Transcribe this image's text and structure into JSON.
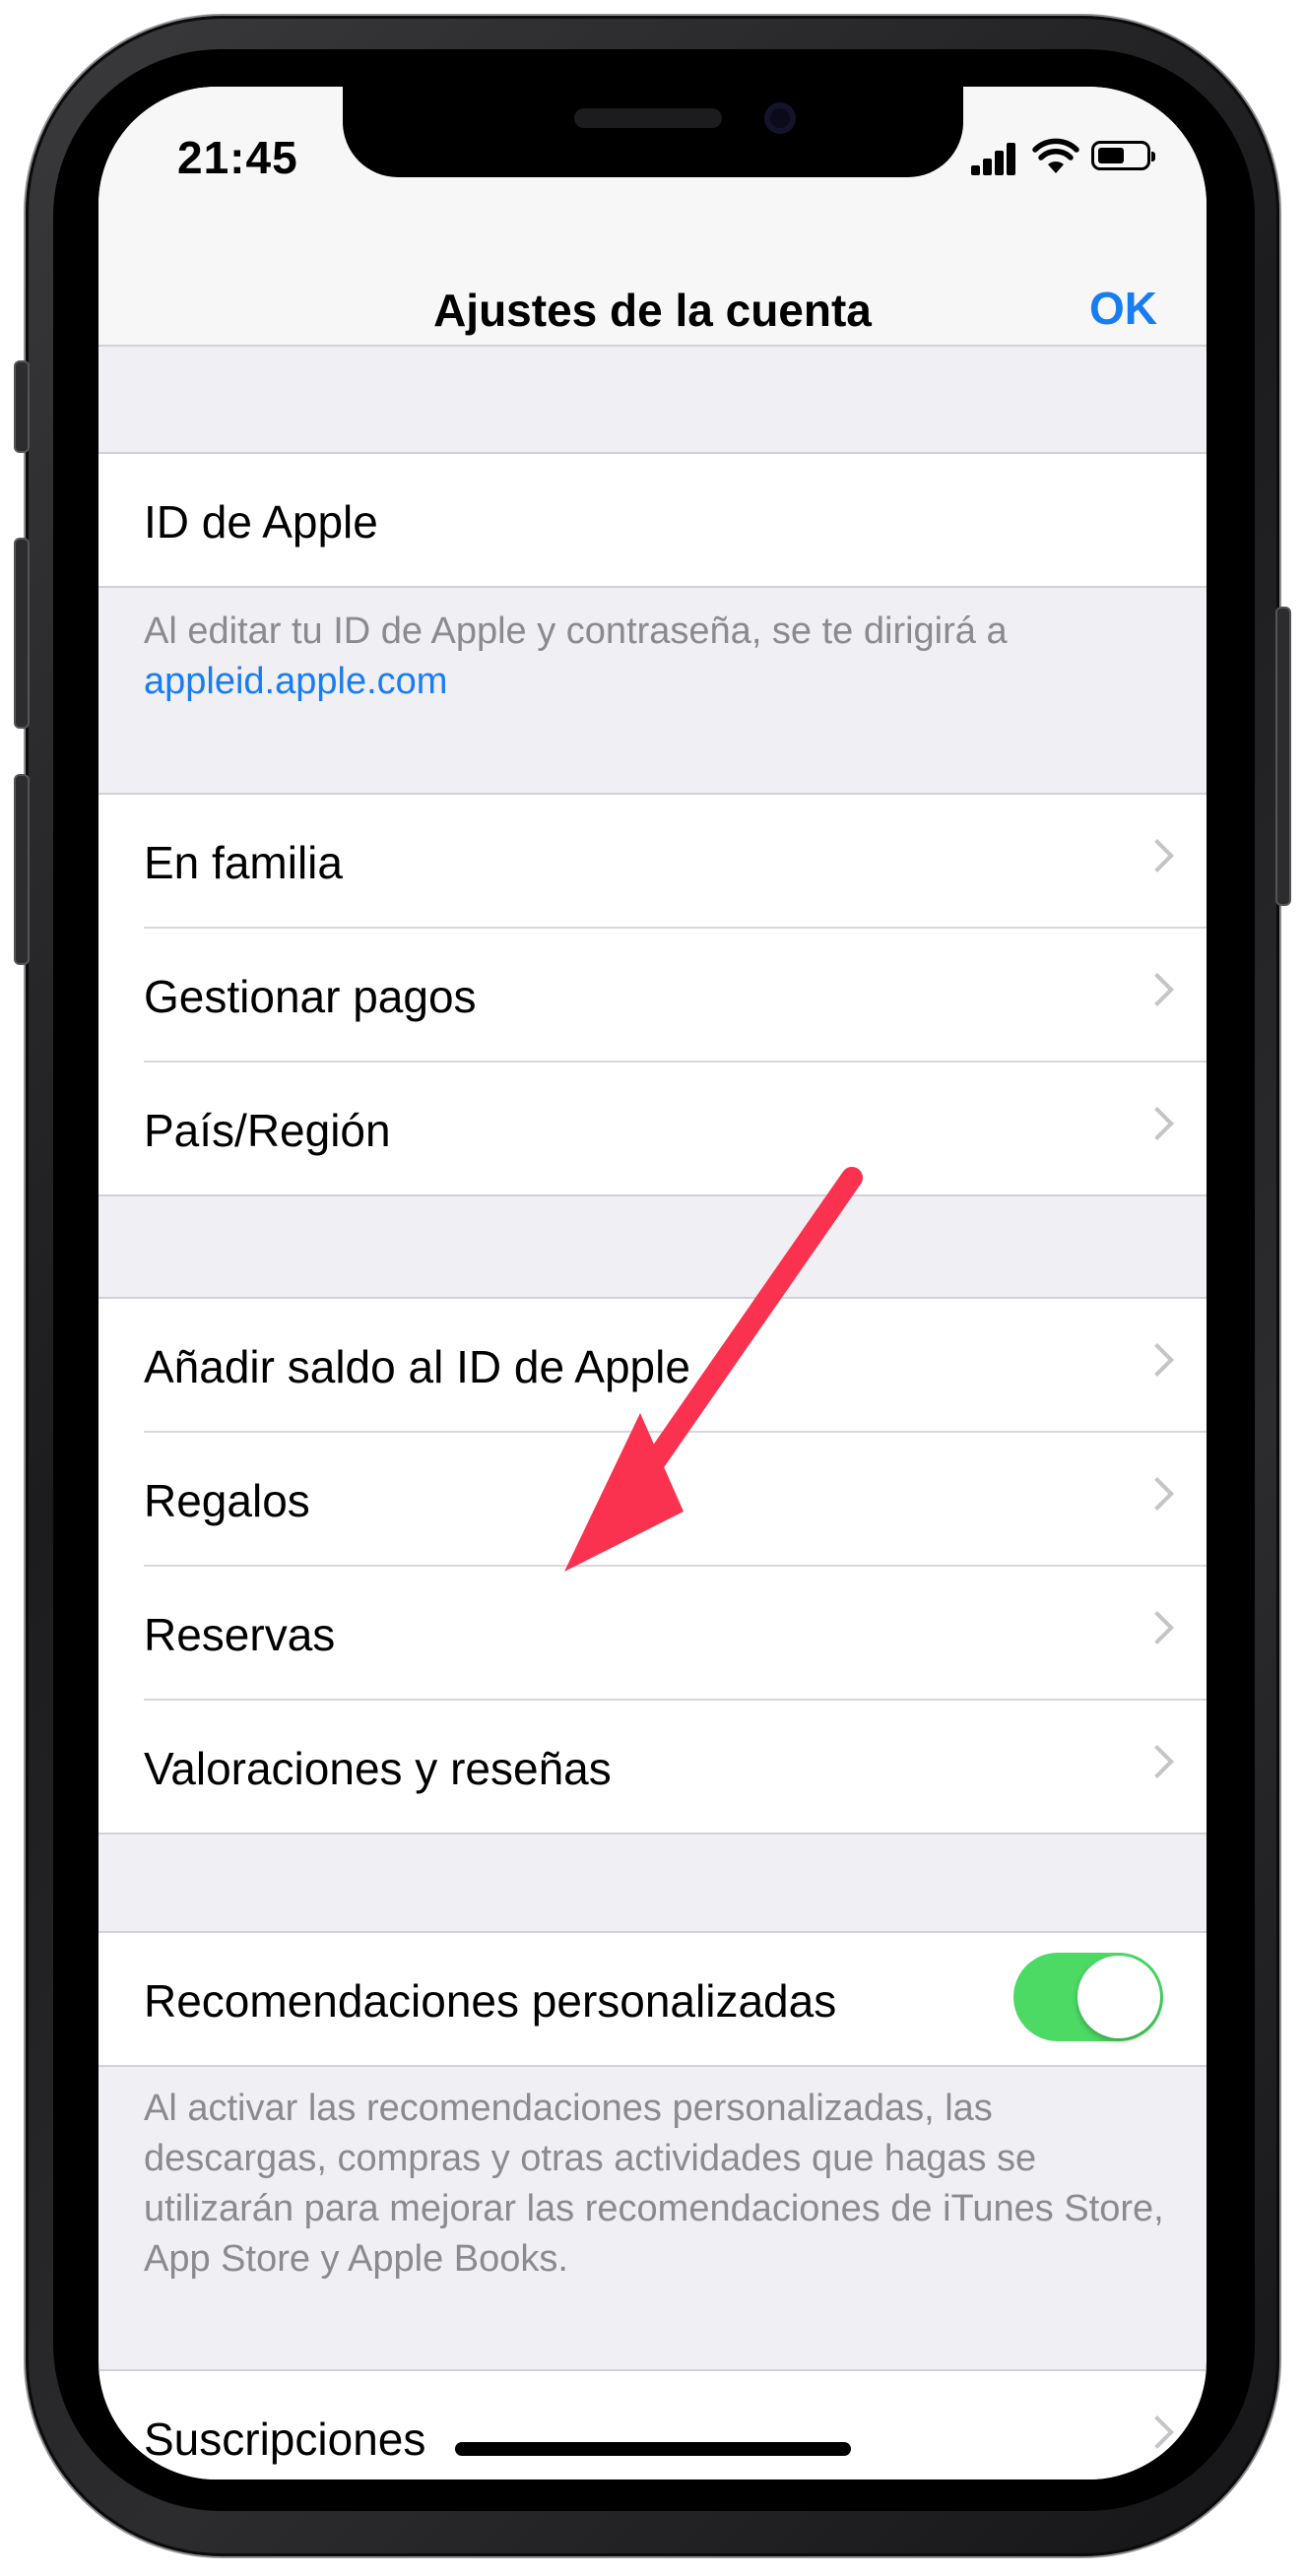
{
  "status_bar": {
    "time": "21:45"
  },
  "nav": {
    "title": "Ajustes de la cuenta",
    "done_label": "OK"
  },
  "apple_id": {
    "label": "ID de Apple",
    "note_text": "Al editar tu ID de Apple y contraseña, se te dirigirá a",
    "note_link": "appleid.apple.com"
  },
  "group1": [
    {
      "label": "En familia"
    },
    {
      "label": "Gestionar pagos"
    },
    {
      "label": "País/Región"
    }
  ],
  "group2": [
    {
      "label": "Añadir saldo al ID de Apple"
    },
    {
      "label": "Regalos"
    },
    {
      "label": "Reservas"
    },
    {
      "label": "Valoraciones y reseñas"
    }
  ],
  "recommendations": {
    "label": "Recomendaciones personalizadas",
    "toggle_on": true,
    "note": "Al activar las recomendaciones personalizadas, las descargas, compras y otras actividades que hagas se utilizarán para mejorar las recomendaciones de iTunes Store, App Store y Apple Books."
  },
  "group3": [
    {
      "label": "Suscripciones"
    }
  ],
  "colors": {
    "accent": "#1a7cf1",
    "toggle_on": "#4cd964",
    "arrow": "#fa3250"
  }
}
